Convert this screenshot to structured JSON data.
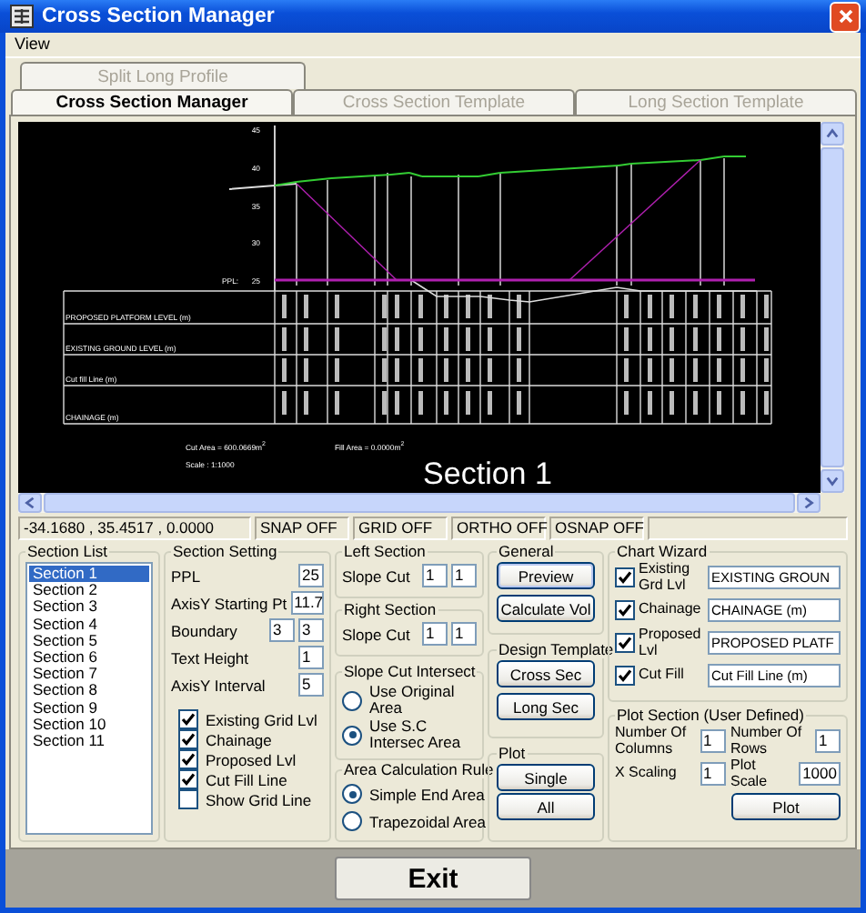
{
  "window": {
    "title": "Cross Section Manager"
  },
  "menu": [
    "View"
  ],
  "tabs_back": [
    {
      "label": "Split Long Profile",
      "selected": false
    }
  ],
  "tabs": [
    {
      "label": "Cross Section Manager",
      "selected": true
    },
    {
      "label": "Cross Section Template",
      "selected": false
    },
    {
      "label": "Long Section Template",
      "selected": false
    }
  ],
  "drawing": {
    "y_ticks": [
      "45",
      "40",
      "35",
      "30",
      "25"
    ],
    "ppl_label": "PPL:",
    "row_labels": [
      "PROPOSED PLATFORM LEVEL (m)",
      "EXISTING GROUND LEVEL (m)",
      "Cut fill Line (m)",
      "CHAINAGE (m)"
    ],
    "cut_area": "Cut Area = 600.0669m$^{2}$",
    "fill_area": "Fill Area = 0.0000m$^{2}$",
    "scale": "Scale : 1:1000",
    "title": "Section 1"
  },
  "status_bar": {
    "coordinates": "-34.1680 , 35.4517 , 0.0000",
    "toggles": [
      "SNAP OFF",
      "GRID OFF",
      "ORTHO OFF",
      "OSNAP OFF"
    ]
  },
  "section_list": {
    "title": "Section List",
    "items": [
      {
        "label": "Section 1",
        "selected": true
      },
      {
        "label": "Section 2",
        "selected": false
      },
      {
        "label": "Section 3",
        "selected": false
      },
      {
        "label": "Section 4",
        "selected": false
      },
      {
        "label": "Section 5",
        "selected": false
      },
      {
        "label": "Section 6",
        "selected": false
      },
      {
        "label": "Section 7",
        "selected": false
      },
      {
        "label": "Section 8",
        "selected": false
      },
      {
        "label": "Section 9",
        "selected": false
      },
      {
        "label": "Section 10",
        "selected": false
      },
      {
        "label": "Section 11",
        "selected": false
      }
    ]
  },
  "section_setting": {
    "title": "Section Setting",
    "fields": [
      {
        "label": "PPL",
        "values": [
          "25"
        ]
      },
      {
        "label": "AxisY Starting Pt",
        "values": [
          "11.7"
        ]
      },
      {
        "label": "Boundary",
        "values": [
          "3",
          "3"
        ]
      },
      {
        "label": "Text Height",
        "values": [
          "1"
        ]
      },
      {
        "label": "AxisY Interval",
        "values": [
          "5"
        ]
      }
    ],
    "checkboxes": [
      {
        "label": "Existing Grid Lvl",
        "checked": true
      },
      {
        "label": "Chainage",
        "checked": true
      },
      {
        "label": "Proposed Lvl",
        "checked": true
      },
      {
        "label": "Cut Fill Line",
        "checked": true
      },
      {
        "label": "Show Grid Line",
        "checked": false
      }
    ]
  },
  "left_section": {
    "title": "Left Section",
    "label": "Slope Cut",
    "values": [
      "1",
      "1"
    ]
  },
  "right_section": {
    "title": "Right Section",
    "label": "Slope Cut",
    "values": [
      "1",
      "1"
    ]
  },
  "slope_cut_intersect": {
    "title": "Slope Cut Intersect",
    "options": [
      {
        "label": "Use Original Area",
        "selected": false
      },
      {
        "label": "Use S.C Intersec Area",
        "selected": true
      }
    ]
  },
  "area_calculation_rule": {
    "title": "Area Calculation Rule",
    "options": [
      {
        "label": "Simple End Area",
        "selected": true
      },
      {
        "label": "Trapezoidal Area",
        "selected": false
      }
    ]
  },
  "general": {
    "title": "General",
    "buttons": [
      "Preview",
      "Calculate Vol"
    ]
  },
  "design_template": {
    "title": "Design Template",
    "buttons": [
      "Cross Sec",
      "Long Sec"
    ]
  },
  "plot": {
    "title": "Plot",
    "buttons": [
      "Single",
      "All"
    ]
  },
  "chart_wizard": {
    "title": "Chart Wizard",
    "rows": [
      {
        "label": "Existing Grd Lvl",
        "checked": true,
        "value": "EXISTING GROUN"
      },
      {
        "label": "Chainage",
        "checked": true,
        "value": "CHAINAGE (m)"
      },
      {
        "label": "Proposed Lvl",
        "checked": true,
        "value": "PROPOSED PLATF"
      },
      {
        "label": "Cut Fill",
        "checked": true,
        "value": "Cut Fill Line (m)"
      }
    ]
  },
  "plot_section": {
    "title": "Plot Section (User Defined)",
    "fields": [
      {
        "label": "Number Of Columns",
        "value": "1"
      },
      {
        "label": "Number Of Rows",
        "value": "1"
      },
      {
        "label": "X Scaling",
        "value": "1"
      },
      {
        "label": "Plot Scale",
        "value": "1000"
      }
    ],
    "button": "Plot"
  },
  "exit_button": "Exit"
}
